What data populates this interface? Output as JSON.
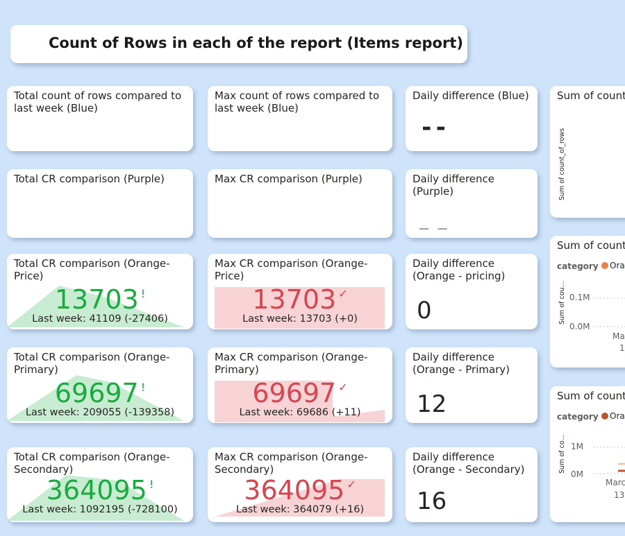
{
  "title": "Count of Rows in each of the report (Items report)",
  "colors": {
    "background": "#cfe3fa",
    "good": "#1aab40",
    "bad": "#d64550",
    "good_fill": "#c8ecd2",
    "bad_fill": "#f7d3d6",
    "orange": "#e8804a",
    "orange_dark": "#b5582a"
  },
  "cards": {
    "total_blue": {
      "label": "Total count of rows compared to last week (Blue)"
    },
    "max_blue": {
      "label": "Max count of rows compared to last week (Blue)"
    },
    "daily_blue": {
      "label": "Daily difference (Blue)",
      "value": "--"
    },
    "total_purple": {
      "label": "Total CR comparison (Purple)"
    },
    "max_purple": {
      "label": "Max CR comparison (Purple)"
    },
    "daily_purple": {
      "label": "Daily difference (Purple)",
      "value": "_ _"
    },
    "total_orange_price": {
      "label": "Total CR comparison (Orange-Price)",
      "value": "13703",
      "status_icon": "exclamation-icon",
      "sub": "Last week: 41109 (-27406)"
    },
    "max_orange_price": {
      "label": "Max CR comparison (Orange-Price)",
      "value": "13703",
      "status_icon": "check-icon",
      "sub": "Last week: 13703 (+0)"
    },
    "daily_orange_pricing": {
      "label": "Daily difference (Orange - pricing)",
      "value": "0"
    },
    "total_orange_primary": {
      "label": "Total CR comparison (Orange-Primary)",
      "value": "69697",
      "status_icon": "exclamation-icon",
      "sub": "Last week: 209055 (-139358)"
    },
    "max_orange_primary": {
      "label": "Max CR comparison (Orange-Primary)",
      "value": "69697",
      "status_icon": "check-icon",
      "sub": "Last week: 69686 (+11)"
    },
    "daily_orange_primary": {
      "label": "Daily difference (Orange - Primary)",
      "value": "12"
    },
    "total_orange_secondary": {
      "label": "Total CR comparison (Orange-Secondary)",
      "value": "364095",
      "status_icon": "exclamation-icon",
      "sub": "Last week: 1092195 (-728100)"
    },
    "max_orange_secondary": {
      "label": "Max CR comparison (Orange-Secondary)",
      "value": "364095",
      "status_icon": "check-icon",
      "sub": "Last week: 364079 (+16)"
    },
    "daily_orange_secondary": {
      "label": "Daily difference (Orange - Secondary)",
      "value": "16"
    }
  },
  "right_panels": {
    "panel1": {
      "title": "Sum of count",
      "ylabel": "Sum of count_of_rows"
    },
    "panel2": {
      "title": "Sum of count",
      "legend_label": "category",
      "legend_item": "Ora",
      "ylabel": "Sum of cou...",
      "ticks": [
        "0.1M",
        "0.0M"
      ],
      "xlabel": "Ma",
      "xsub": "1"
    },
    "panel3": {
      "title": "Sum of count",
      "legend_label": "category",
      "legend_item": "Ora",
      "ylabel": "Sum of co...",
      "ticks": [
        "1M",
        "0M"
      ],
      "xlabel": "Marc",
      "xsub": "13"
    }
  }
}
